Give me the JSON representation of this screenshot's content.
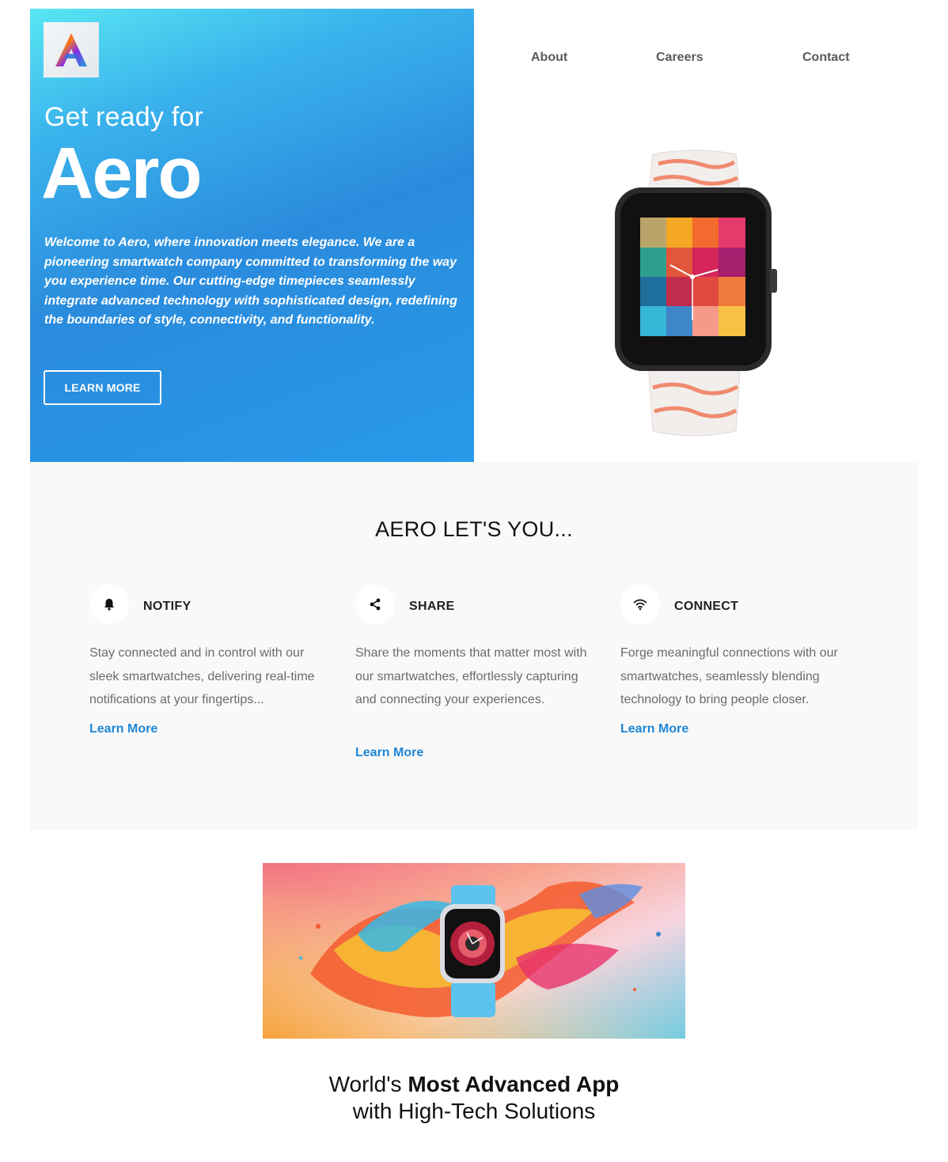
{
  "brand": {
    "logo_icon": "aero-a-logo",
    "colors": {
      "hero_gradient_start": "#59e6f3",
      "hero_gradient_end": "#279ae8",
      "link": "#1f86d6"
    }
  },
  "nav": {
    "items": [
      {
        "label": "About"
      },
      {
        "label": "Careers"
      },
      {
        "label": "Contact"
      }
    ]
  },
  "hero": {
    "subtitle": "Get ready for",
    "title": "Aero",
    "description": "Welcome to Aero, where innovation meets elegance. We are a pioneering smartwatch company committed to transforming the way you experience time. Our cutting-edge timepieces seamlessly integrate advanced technology with sophisticated design, redefining the boundaries of style, connectivity, and functionality.",
    "cta_label": "LEARN MORE"
  },
  "features": {
    "heading": "AERO LET'S YOU...",
    "items": [
      {
        "icon": "bell-icon",
        "title": "NOTIFY",
        "text": "Stay connected and in control with our sleek smartwatches, delivering real-time notifications at your fingertips...",
        "link": "Learn More"
      },
      {
        "icon": "share-icon",
        "title": "SHARE",
        "text": "Share the moments that matter most with our smartwatches, effortlessly capturing and connecting your experiences.",
        "link": "Learn More"
      },
      {
        "icon": "wifi-icon",
        "title": "CONNECT",
        "text": "Forge meaningful connections with our smartwatches, seamlessly blending technology to bring people closer.",
        "link": "Learn More"
      }
    ]
  },
  "tagline": {
    "prefix": "World's",
    "bold": "Most Advanced App",
    "line2": "with High-Tech Solutions"
  }
}
